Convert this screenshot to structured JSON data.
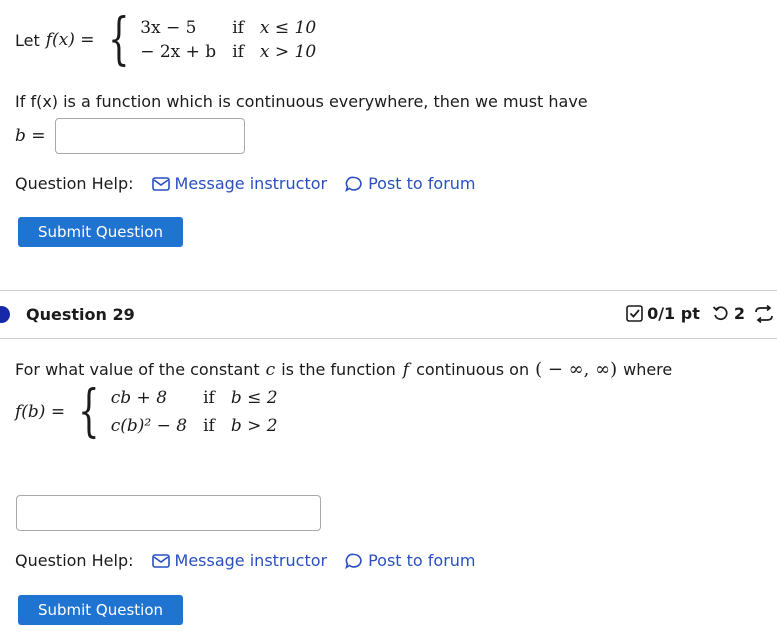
{
  "q28": {
    "intro": "Let",
    "func": "f(x) =",
    "cases": [
      {
        "expr": "3x − 5",
        "cond_word": "if",
        "cond": "x ≤ 10"
      },
      {
        "expr": "− 2x + b",
        "cond_word": "if",
        "cond": "x > 10"
      }
    ],
    "prompt": "If f(x) is a function which is continuous everywhere, then we must have",
    "answer_label": "b =",
    "answer_value": "",
    "help_label": "Question Help:",
    "message_link": "Message instructor",
    "forum_link": "Post to forum",
    "submit_label": "Submit Question"
  },
  "q29": {
    "title": "Question 29",
    "score": "0/1 pt",
    "attempts": "2",
    "prompt_start": "For what value of the constant",
    "const": "c",
    "prompt_mid": "is the function",
    "fname": "f",
    "prompt_mid2": "continuous on",
    "interval": "( − ∞, ∞)",
    "prompt_end": "where",
    "func": "f(b) =",
    "cases": [
      {
        "expr": "cb + 8",
        "cond_word": "if",
        "cond": "b ≤ 2"
      },
      {
        "expr": "c(b)² − 8",
        "cond_word": "if",
        "cond": "b > 2"
      }
    ],
    "answer_value": "",
    "help_label": "Question Help:",
    "message_link": "Message instructor",
    "forum_link": "Post to forum",
    "submit_label": "Submit Question"
  },
  "colors": {
    "accent": "#1f74d1",
    "link": "#2a4fc2",
    "dot": "#1728a8"
  },
  "icons": [
    "envelope-icon",
    "speech-bubble-icon",
    "checkbox-icon",
    "retry-icon",
    "refresh-icon"
  ]
}
